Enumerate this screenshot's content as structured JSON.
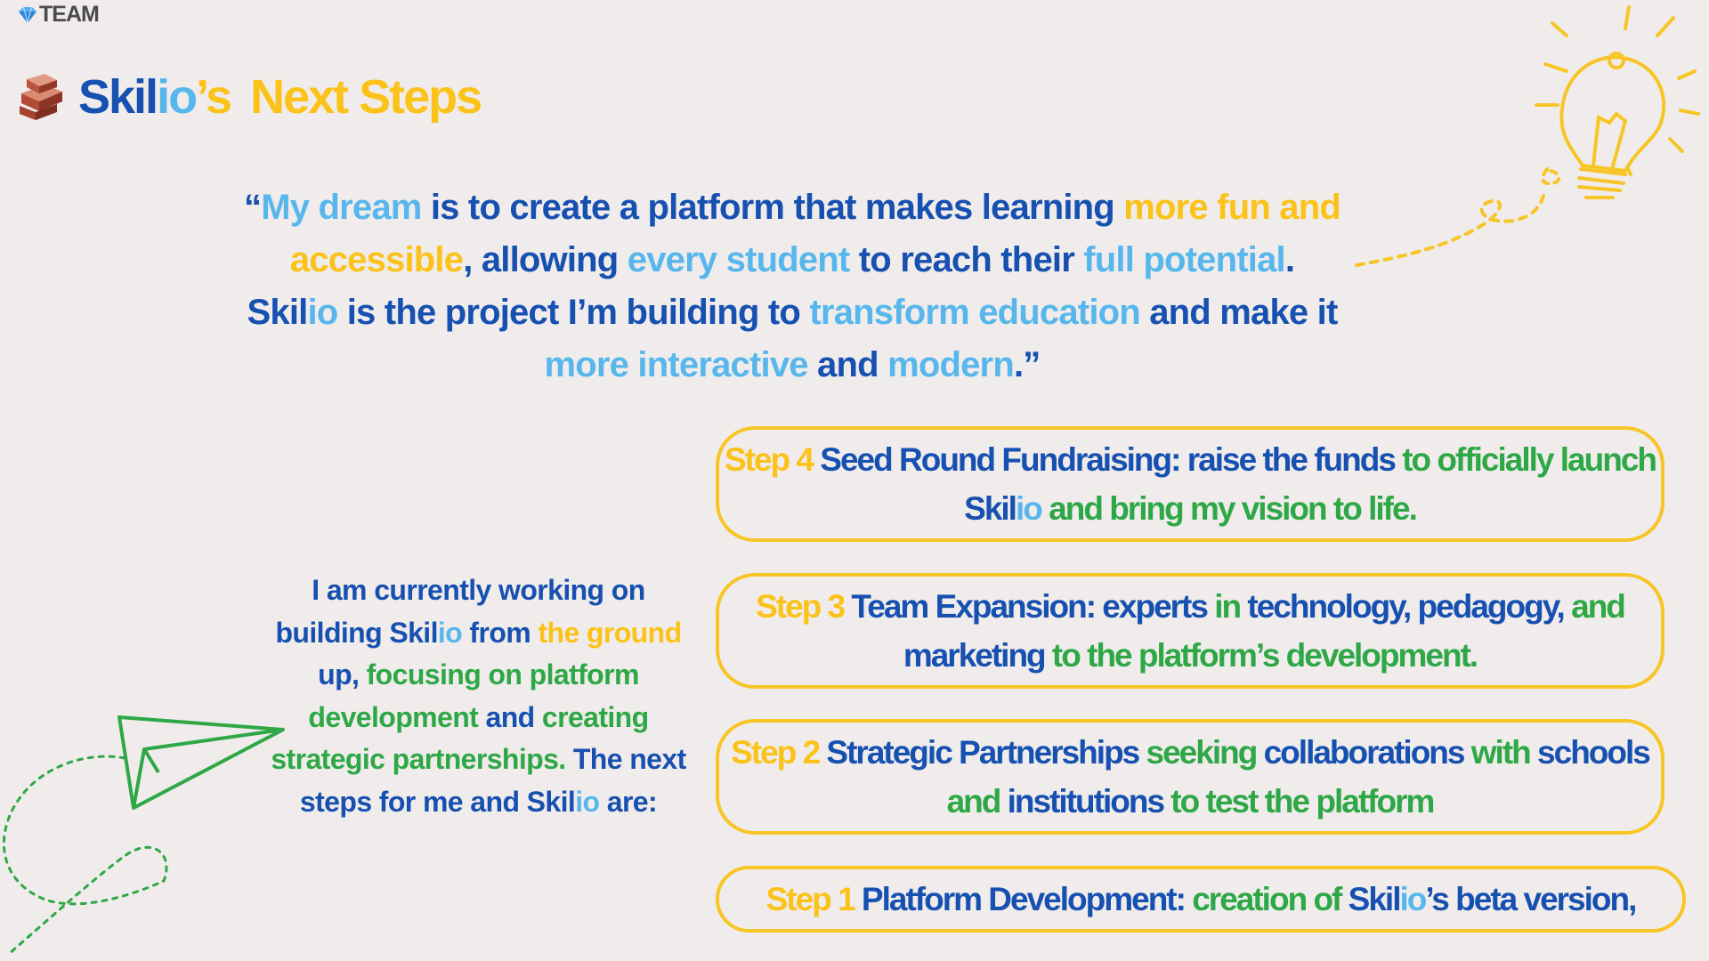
{
  "badge": {
    "label": "TEAM",
    "icon": "gem-icon"
  },
  "title": {
    "icon": "brick-icon",
    "brand_a": "Skil",
    "brand_b": "io",
    "possessive": "’s",
    "rest": "Next Steps"
  },
  "quote": {
    "l1": {
      "a": "“",
      "b": "My dream",
      "c": " is to create a platform that makes learning ",
      "d": "more fun and"
    },
    "l2": {
      "a": "accessible",
      "b": ", allowing ",
      "c": "every student",
      "d": " to reach their ",
      "e": "full potential",
      "f": "."
    },
    "l3": {
      "a": "Skil",
      "b": "io",
      "c": " is the project I’m building to ",
      "d": "transform education",
      "e": " and make it"
    },
    "l4": {
      "a": "more interactive",
      "b": " and ",
      "c": "modern",
      "d": ".”"
    }
  },
  "intro": {
    "l1": {
      "a": "I am currently working on"
    },
    "l2": {
      "a": "building Skil",
      "b": "io",
      "c": " from ",
      "d": "the ground"
    },
    "l3": {
      "a": "up, ",
      "b": "focusing on platform"
    },
    "l4": {
      "a": "development",
      "b": " and ",
      "c": "creating"
    },
    "l5": {
      "a": "strategic partnerships.",
      "b": " The next"
    },
    "l6": {
      "a": "steps for me and Skil",
      "b": "io",
      "c": " are:"
    }
  },
  "steps": {
    "s4": {
      "l1": {
        "a": "Step 4",
        "b": " Seed Round Fundraising",
        "c": ": raise the  ",
        "d": "funds",
        "e": " to officially launch"
      },
      "l2": {
        "a": "Skil",
        "b": "io",
        "c": " and bring my vision to life."
      }
    },
    "s3": {
      "l1": {
        "a": "Step 3",
        "b": " Team Expansion:  experts",
        "c": " in ",
        "d": "technology, pedagogy,",
        "e": " and"
      },
      "l2": {
        "a": "marketing",
        "b": " to  the platform’s development."
      }
    },
    "s2": {
      "l1": {
        "a": "Step 2",
        "b": " Strategic Partnerships",
        "c": " seeking ",
        "d": "collaborations",
        "e": " with ",
        "f": "schools"
      },
      "l2": {
        "a": "and ",
        "b": "institutions",
        "c": " to test the platform"
      }
    },
    "s1": {
      "l1": {
        "a": "Step 1",
        "b": "  Platform Development:",
        "c": "  creation of ",
        "d": "Skil",
        "e": "io",
        "f": "’s beta version,"
      }
    }
  },
  "decorations": {
    "lightbulb": "lightbulb-icon",
    "paper_plane": "paper-plane-icon"
  },
  "colors": {
    "navy": "#1650b0",
    "sky": "#57b7ec",
    "yellow": "#fbc21a",
    "green": "#2ea846",
    "background": "#f1ecec"
  }
}
